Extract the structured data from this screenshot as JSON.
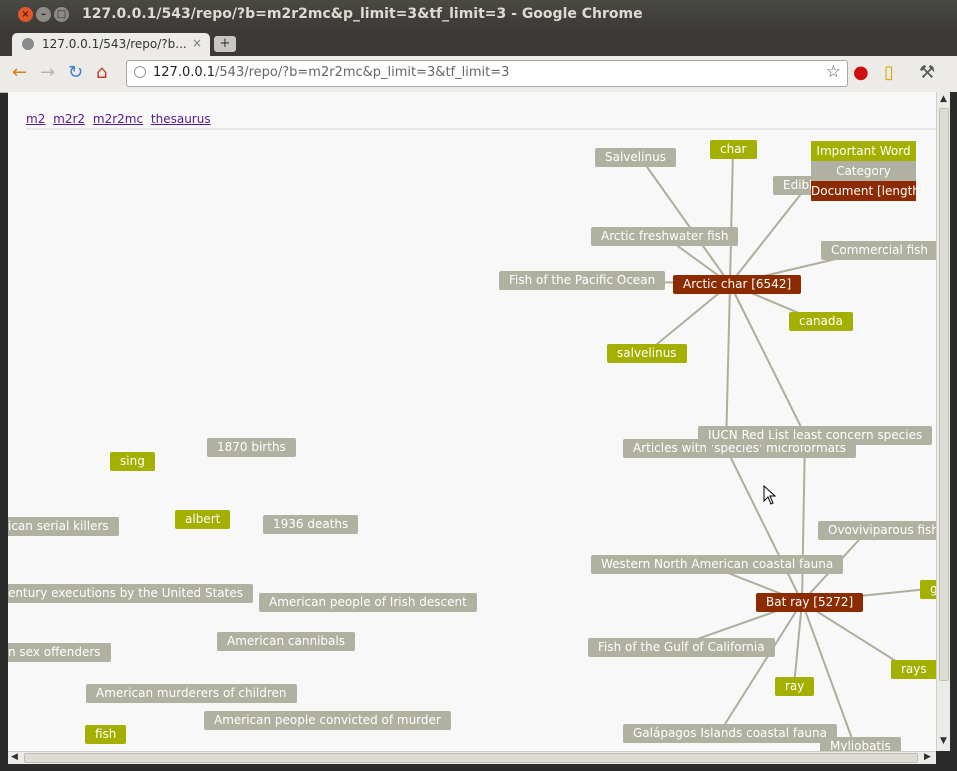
{
  "window": {
    "title": "127.0.0.1/543/repo/?b=m2r2mc&p_limit=3&tf_limit=3 - Google Chrome"
  },
  "tab": {
    "label": "127.0.0.1/543/repo/?b...",
    "close_glyph": "×",
    "new_tab_glyph": "+"
  },
  "toolbar": {
    "url_host": "127.0.0.1",
    "url_path": "/543/repo/?b=m2r2mc&p_limit=3&tf_limit=3"
  },
  "nav_links": [
    "m2",
    "m2r2",
    "m2r2mc",
    "thesaurus"
  ],
  "legend": {
    "important_word": "Important Word",
    "category": "Category",
    "document": "Document [length]"
  },
  "colors": {
    "word": "#a4b000",
    "category": "#b1b1a2",
    "document": "#8c2a00",
    "edge": "#b0ad9c"
  },
  "nodes": {
    "salvelinus_cat": "Salvelinus",
    "char": "char",
    "edible": "Edibl",
    "arctic_freshwater": "Arctic freshwater fish",
    "commercial_fish": "Commercial fish",
    "fish_pacific": "Fish of the Pacific Ocean",
    "arctic_char": "Arctic char [6542]",
    "canada": "canada",
    "salvelinus_word": "salvelinus",
    "iucn": "IUCN Red List least concern species",
    "articles_species": "Articles with 'species' microformats",
    "sing": "sing",
    "births_1870": "1870 births",
    "serial_killers": "ican serial killers",
    "albert": "albert",
    "deaths_1936": "1936 deaths",
    "ovoviviparous": "Ovoviviparous fish",
    "western_na": "Western North American coastal fauna",
    "bat_ray": "Bat ray [5272]",
    "g_partial": "g",
    "executions": "entury executions by the United States",
    "irish_descent": "American people of Irish descent",
    "cannibals": "American cannibals",
    "sex_offenders": "n sex offenders",
    "gulf_california": "Fish of the Gulf of California",
    "rays": "rays",
    "ray": "ray",
    "murderers_children": "American murderers of children",
    "convicted_murder": "American people convicted of murder",
    "fish": "fish",
    "galapagos": "Galápagos Islands coastal fauna",
    "myliobatis": "Myliobatis"
  }
}
